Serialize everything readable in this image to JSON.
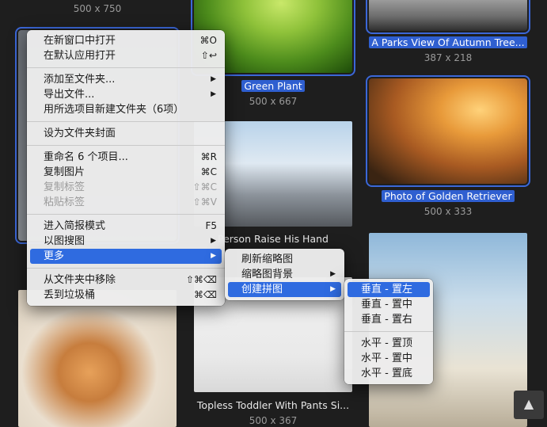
{
  "grid": {
    "top_left_dim": "500 x 750",
    "plant_caption": "Green Plant",
    "plant_dim": "500 x 667",
    "swing_caption": "A Parks View Of Autumn Tree...",
    "swing_dim": "387 x 218",
    "dog_caption": "Photo of Golden Retriever",
    "dog_dim": "500 x 333",
    "city_caption": "Person Raise His Hand",
    "toddler_caption": "Topless Toddler With Pants Si...",
    "toddler_dim": "500 x 367"
  },
  "context_menu": {
    "items": [
      {
        "label": "在新窗口中打开",
        "shortcut": "⌘O"
      },
      {
        "label": "在默认应用打开",
        "shortcut": "⇧↩"
      },
      {
        "label": "添加至文件夹...",
        "submenu": true
      },
      {
        "label": "导出文件...",
        "submenu": true
      },
      {
        "label": "用所选项目新建文件夹（6项）"
      },
      {
        "label": "设为文件夹封面"
      },
      {
        "label": "重命名 6 个项目...",
        "shortcut": "⌘R"
      },
      {
        "label": "复制图片",
        "shortcut": "⌘C"
      },
      {
        "label": "复制标签",
        "shortcut": "⇧⌘C",
        "disabled": true
      },
      {
        "label": "粘贴标签",
        "shortcut": "⇧⌘V",
        "disabled": true
      },
      {
        "label": "进入简报模式",
        "shortcut": "F5"
      },
      {
        "label": "以图搜图",
        "submenu": true
      },
      {
        "label": "更多",
        "submenu": true,
        "active": true
      },
      {
        "label": "从文件夹中移除",
        "shortcut": "⇧⌘⌫"
      },
      {
        "label": "丢到垃圾桶",
        "shortcut": "⌘⌫"
      }
    ]
  },
  "more_menu": {
    "items": [
      {
        "label": "刷新缩略图"
      },
      {
        "label": "缩略图背景",
        "submenu": true
      },
      {
        "label": "创建拼图",
        "submenu": true,
        "active": true
      }
    ]
  },
  "collage_menu": {
    "items": [
      {
        "label": "垂直 - 置左",
        "active": true
      },
      {
        "label": "垂直 - 置中"
      },
      {
        "label": "垂直 - 置右"
      },
      {
        "label": "水平 - 置顶"
      },
      {
        "label": "水平 - 置中"
      },
      {
        "label": "水平 - 置底"
      }
    ]
  },
  "scroll_to_top_icon": "chevron-up-icon"
}
